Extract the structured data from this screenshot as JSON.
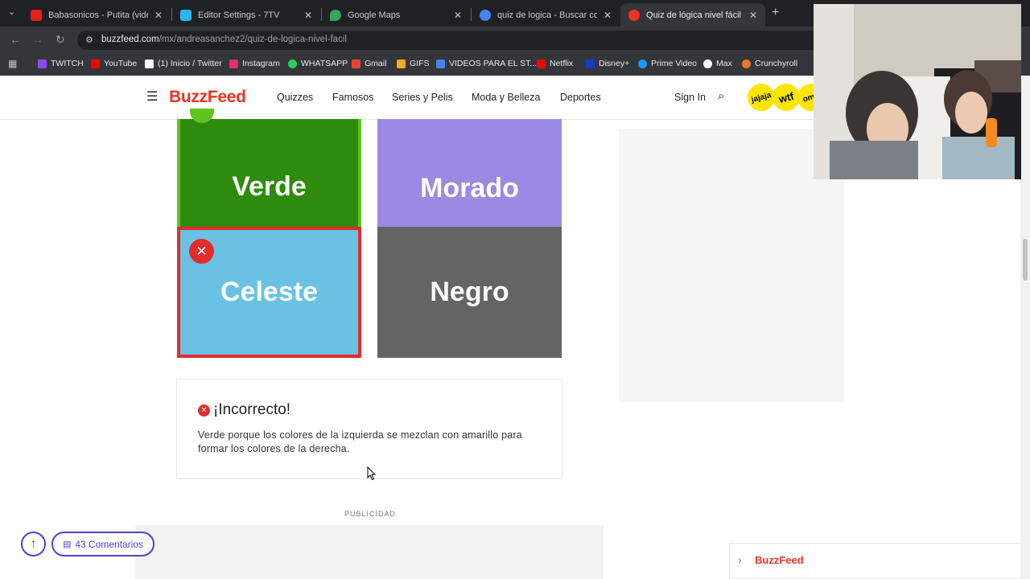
{
  "browser": {
    "tabs": [
      {
        "title": "Babasonicos - Putita (video of",
        "close": "✕",
        "color": "#e62117"
      },
      {
        "title": "Editor Settings - 7TV",
        "close": "✕",
        "color": "#29b6f6"
      },
      {
        "title": "Google Maps",
        "close": "✕",
        "color": "#34a853"
      },
      {
        "title": "quiz de logica - Buscar con Go",
        "close": "✕",
        "color": "#4285f4"
      },
      {
        "title": "Quiz de lógica nivel fácil",
        "close": "✕",
        "color": "#e32"
      }
    ],
    "new_tab": "+",
    "url_host": "buzzfeed.com",
    "url_path": "/mx/andreasanchez2/quiz-de-logica-nivel-facil",
    "bookmarks": [
      {
        "label": "TWITCH",
        "color": "#9146ff"
      },
      {
        "label": "YouTube",
        "color": "#ff0000"
      },
      {
        "label": "(1) Inicio / Twitter",
        "color": "#ffffff"
      },
      {
        "label": "Instagram",
        "color": "#e1306c"
      },
      {
        "label": "WHATSAPP",
        "color": "#25d366"
      },
      {
        "label": "Gmail",
        "color": "#ea4335"
      },
      {
        "label": "GIFS",
        "color": "#f9a825"
      },
      {
        "label": "VIDEOS PARA EL ST...",
        "color": "#4285f4"
      },
      {
        "label": "Netflix",
        "color": "#e50914"
      },
      {
        "label": "Disney+",
        "color": "#113ccf"
      },
      {
        "label": "Prime Video",
        "color": "#1a98ff"
      },
      {
        "label": "Max",
        "color": "#ffffff"
      },
      {
        "label": "Crunchyroll",
        "color": "#f47521"
      }
    ]
  },
  "site": {
    "logo": "BuzzFeed",
    "nav": [
      "Quizzes",
      "Famosos",
      "Series y Pelis",
      "Moda y Belleza",
      "Deportes"
    ],
    "sign_in": "Sign In",
    "badges": [
      "jajaja",
      "wtf",
      "omg"
    ]
  },
  "quiz": {
    "answers": {
      "verde": "Verde",
      "morado": "Morado",
      "celeste": "Celeste",
      "negro": "Negro"
    },
    "wrong_mark": "✕",
    "result_title": "¡Incorrecto!",
    "result_text": "Verde porque los colores de la izquierda se mezclan con amarillo para formar los colores de la derecha."
  },
  "ads": {
    "label": "PUBLICIDAD"
  },
  "floating": {
    "up_arrow": "↑",
    "comments": "43 Comentarios",
    "footer_brand": "BuzzFeed"
  },
  "colors": {
    "brand_red": "#e32",
    "accent_purple": "#4b44d6",
    "wrong_red": "#e32c2c",
    "correct_green": "#2d8b0d"
  }
}
